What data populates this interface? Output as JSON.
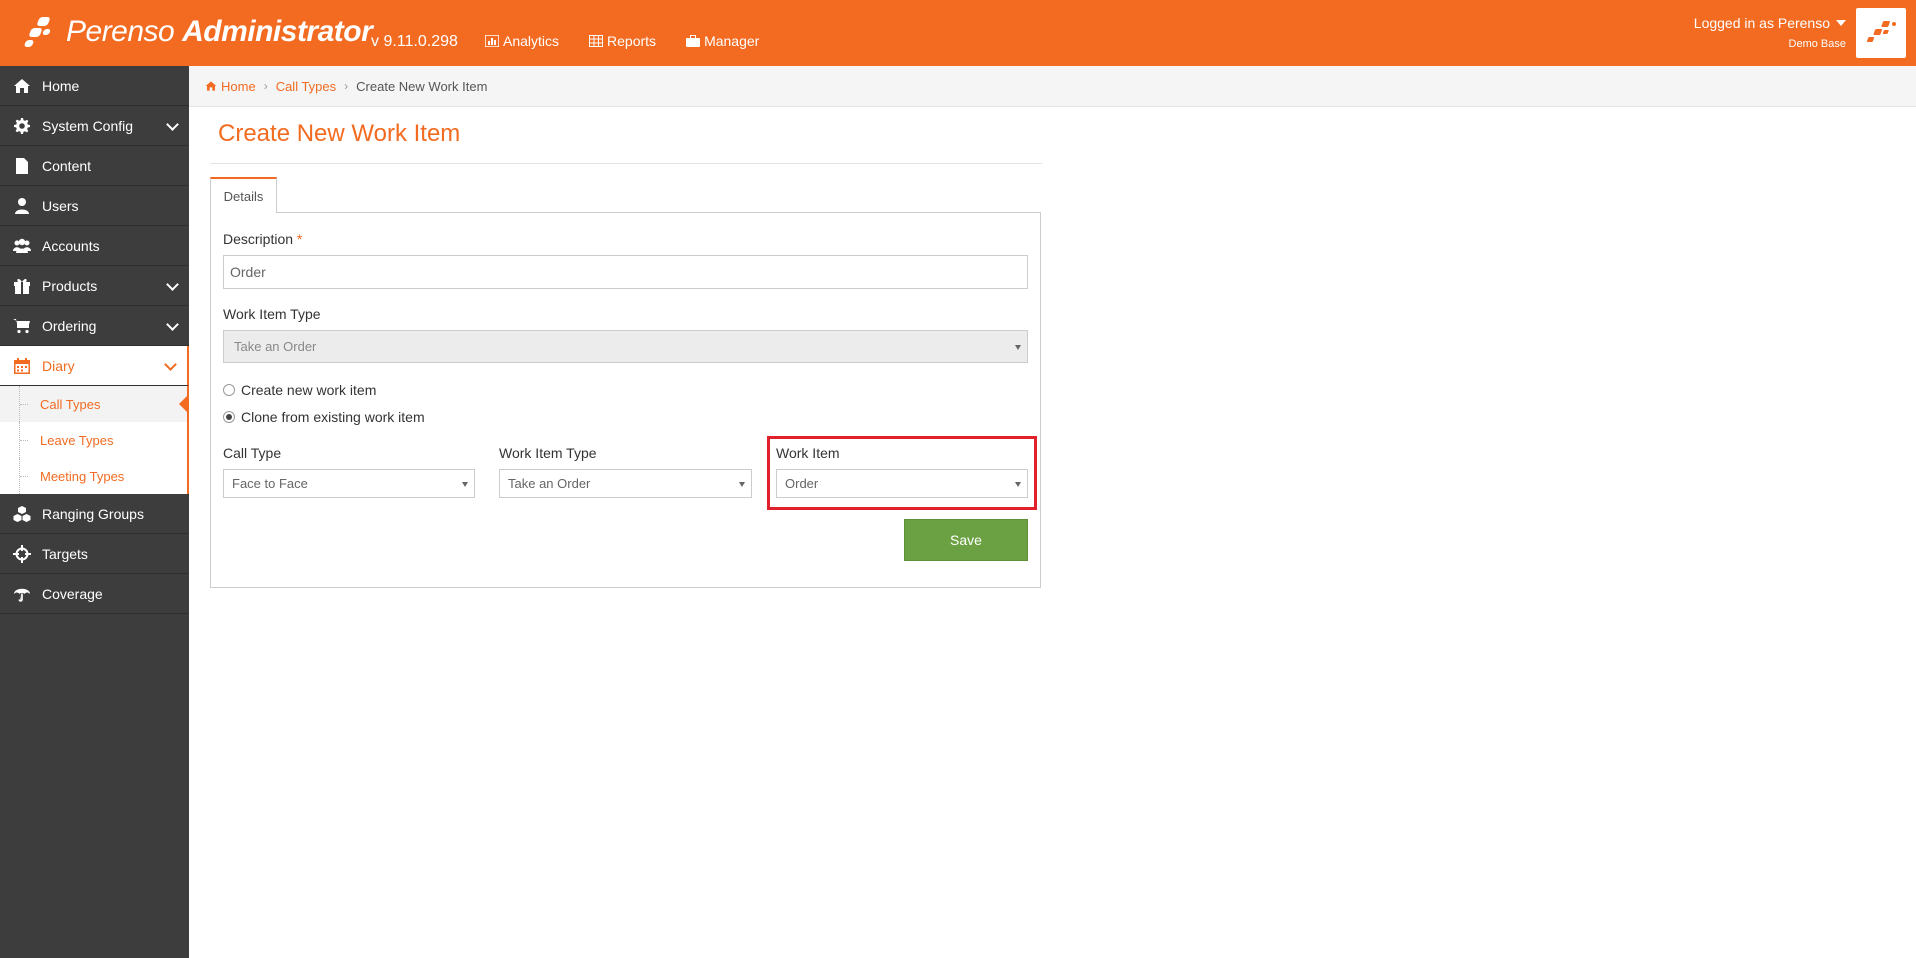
{
  "header": {
    "brand_name": "Perenso",
    "brand_suffix": "Administrator",
    "version": "v 9.11.0.298",
    "nav": [
      {
        "label": "Analytics",
        "icon": "chart-icon"
      },
      {
        "label": "Reports",
        "icon": "table-icon"
      },
      {
        "label": "Manager",
        "icon": "briefcase-icon"
      }
    ],
    "user_label": "Logged in as Perenso",
    "user_sub": "Demo Base"
  },
  "sidebar": {
    "items": [
      {
        "label": "Home",
        "icon": "home-icon"
      },
      {
        "label": "System Config",
        "icon": "gear-icon"
      },
      {
        "label": "Content",
        "icon": "file-icon"
      },
      {
        "label": "Users",
        "icon": "user-icon"
      },
      {
        "label": "Accounts",
        "icon": "users-icon"
      },
      {
        "label": "Products",
        "icon": "gift-icon"
      },
      {
        "label": "Ordering",
        "icon": "cart-icon"
      },
      {
        "label": "Diary",
        "icon": "calendar-icon"
      },
      {
        "label": "Ranging Groups",
        "icon": "cubes-icon"
      },
      {
        "label": "Targets",
        "icon": "crosshairs-icon"
      },
      {
        "label": "Coverage",
        "icon": "umbrella-icon"
      }
    ],
    "diary_sub": [
      "Call Types",
      "Leave Types",
      "Meeting Types"
    ]
  },
  "breadcrumb": {
    "home": "Home",
    "parent": "Call Types",
    "current": "Create New Work Item"
  },
  "page": {
    "title": "Create New Work Item",
    "tab_label": "Details"
  },
  "form": {
    "description_label": "Description",
    "required_mark": "*",
    "description_value": "Order",
    "work_item_type_label": "Work Item Type",
    "work_item_type_value": "Take an Order",
    "radio_create": "Create new work item",
    "radio_clone": "Clone from existing work item",
    "call_type_label": "Call Type",
    "call_type_value": "Face to Face",
    "clone_type_label": "Work Item Type",
    "clone_type_value": "Take an Order",
    "work_item_label": "Work Item",
    "work_item_value": "Order",
    "save_label": "Save"
  },
  "colors": {
    "brand": "#f26b21",
    "sidebar": "#3d3d3d",
    "save": "#6ba143",
    "highlight": "#e0202a"
  }
}
